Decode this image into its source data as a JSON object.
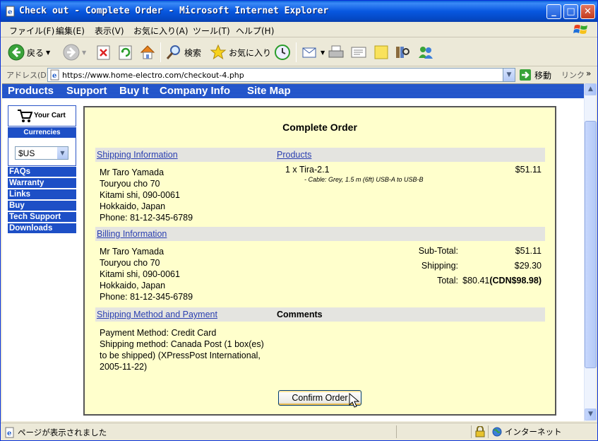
{
  "window": {
    "title": "Check out - Complete Order - Microsoft Internet Explorer",
    "minimize": "_",
    "maximize": "□",
    "close": "✕"
  },
  "menu": [
    "ファイル(F)",
    "編集(E)",
    "表示(V)",
    "お気に入り(A)",
    "ツール(T)",
    "ヘルプ(H)"
  ],
  "toolbar": {
    "back_label": "戻る",
    "search_label": "検索",
    "favorites_label": "お気に入り"
  },
  "address": {
    "label": "アドレス(D)",
    "url": "https://www.home-electro.com/checkout-4.php",
    "go_label": "移動",
    "links_label": "リンク"
  },
  "site_nav": [
    "Products",
    "Support",
    "Buy It",
    "Company Info",
    "Site Map"
  ],
  "sidebar": {
    "cart_label": "Your Cart",
    "currencies_label": "Currencies",
    "currency_value": "$US",
    "links": [
      "FAQs",
      "Warranty",
      "Links",
      "Buy",
      "Tech Support",
      "Downloads"
    ]
  },
  "order": {
    "title": "Complete Order",
    "shipping_heading": "Shipping Information",
    "products_heading": "Products",
    "shipping_address": [
      "Mr Taro Yamada",
      "Touryou cho 70",
      "Kitami shi, 090-0061",
      "Hokkaido, Japan",
      "Phone: 81-12-345-6789"
    ],
    "product": {
      "qty_name": "1 x Tira-2.1",
      "option": "- Cable: Grey, 1.5 m (6ft) USB-A to USB-B",
      "price": "$51.11"
    },
    "billing_heading": "Billing Information",
    "billing_address": [
      "Mr Taro Yamada",
      "Touryou cho 70",
      "Kitami shi, 090-0061",
      "Hokkaido, Japan",
      "Phone: 81-12-345-6789"
    ],
    "totals": {
      "subtotal_label": "Sub-Total:",
      "subtotal_value": "$51.11",
      "shipping_label": "Shipping:",
      "shipping_value": "$29.30",
      "total_label": "Total:",
      "total_value": "$80.41",
      "total_cdn": "(CDN$98.98)"
    },
    "method_heading": "Shipping Method and Payment",
    "comments_heading": "Comments",
    "payment_method": "Payment Method: Credit Card",
    "shipping_method_lines": [
      "Shipping method: Canada Post (1 box(es)",
      "to be shipped) (XPressPost International,",
      "2005-11-22)"
    ],
    "confirm_label": "Confirm Order"
  },
  "status": {
    "text": "ページが表示されました",
    "zone": "インターネット"
  }
}
